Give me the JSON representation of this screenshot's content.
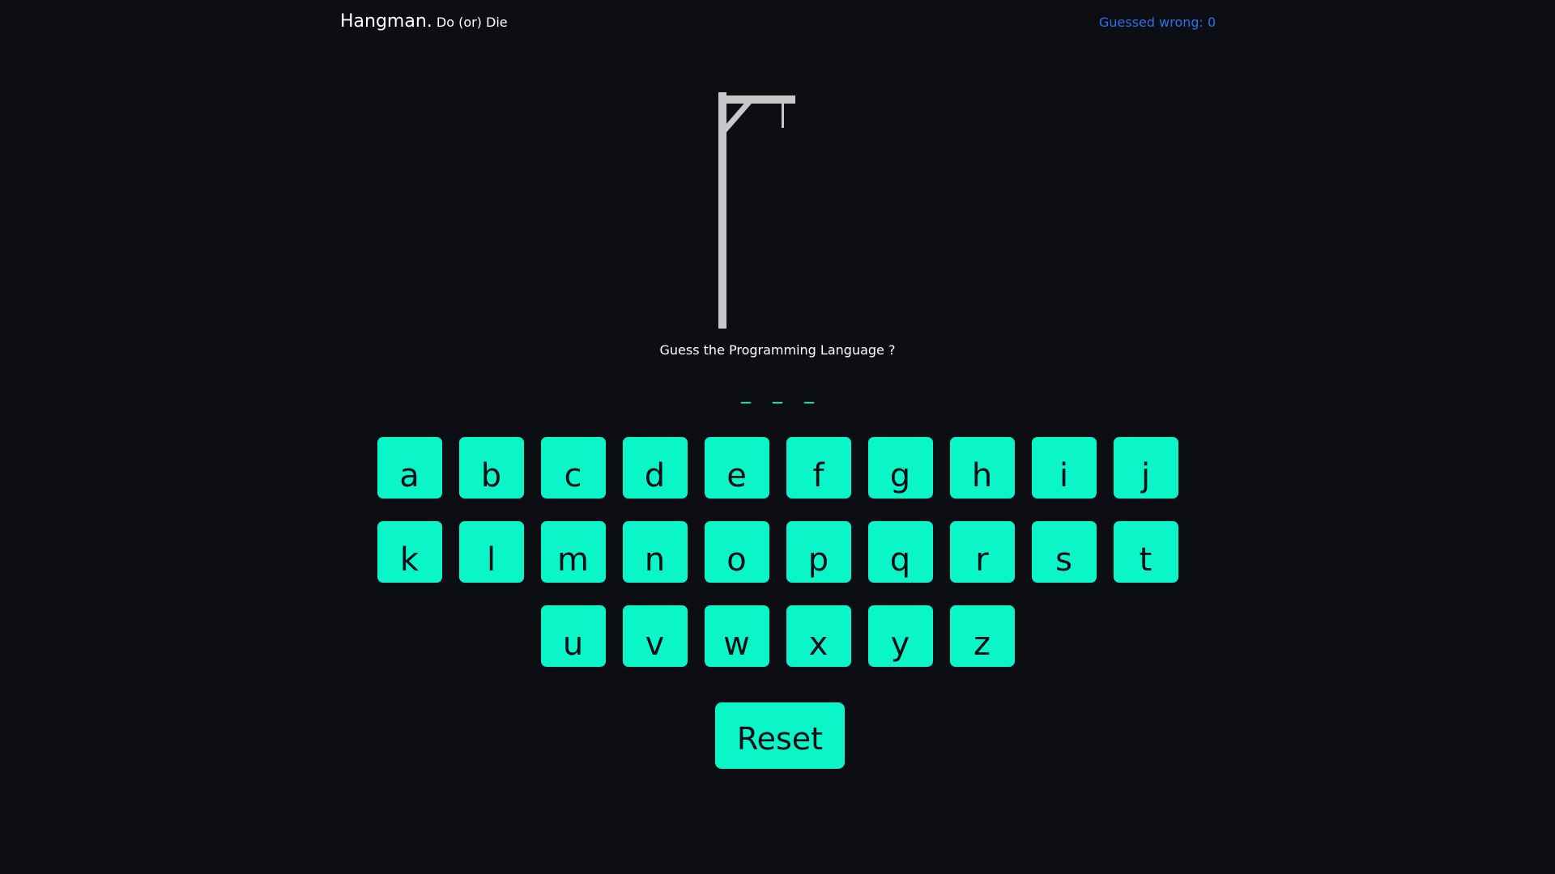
{
  "header": {
    "title": "Hangman.",
    "subtitle": "Do (or) Die",
    "wrong_label": "Guessed wrong: 0"
  },
  "game": {
    "question": "Guess the Programming Language ?",
    "blanks": [
      "_",
      "_",
      "_"
    ],
    "colors": {
      "background": "#0c0e13",
      "accent": "#0af5c8",
      "wrong_text": "#2a72e8",
      "gallows": "#c8c8c8"
    }
  },
  "keyboard": {
    "row1": [
      "a",
      "b",
      "c",
      "d",
      "e",
      "f",
      "g",
      "h",
      "i",
      "j"
    ],
    "row2": [
      "k",
      "l",
      "m",
      "n",
      "o",
      "p",
      "q",
      "r",
      "s",
      "t"
    ],
    "row3": [
      "u",
      "v",
      "w",
      "x",
      "y",
      "z"
    ]
  },
  "controls": {
    "reset_label": "Reset"
  }
}
